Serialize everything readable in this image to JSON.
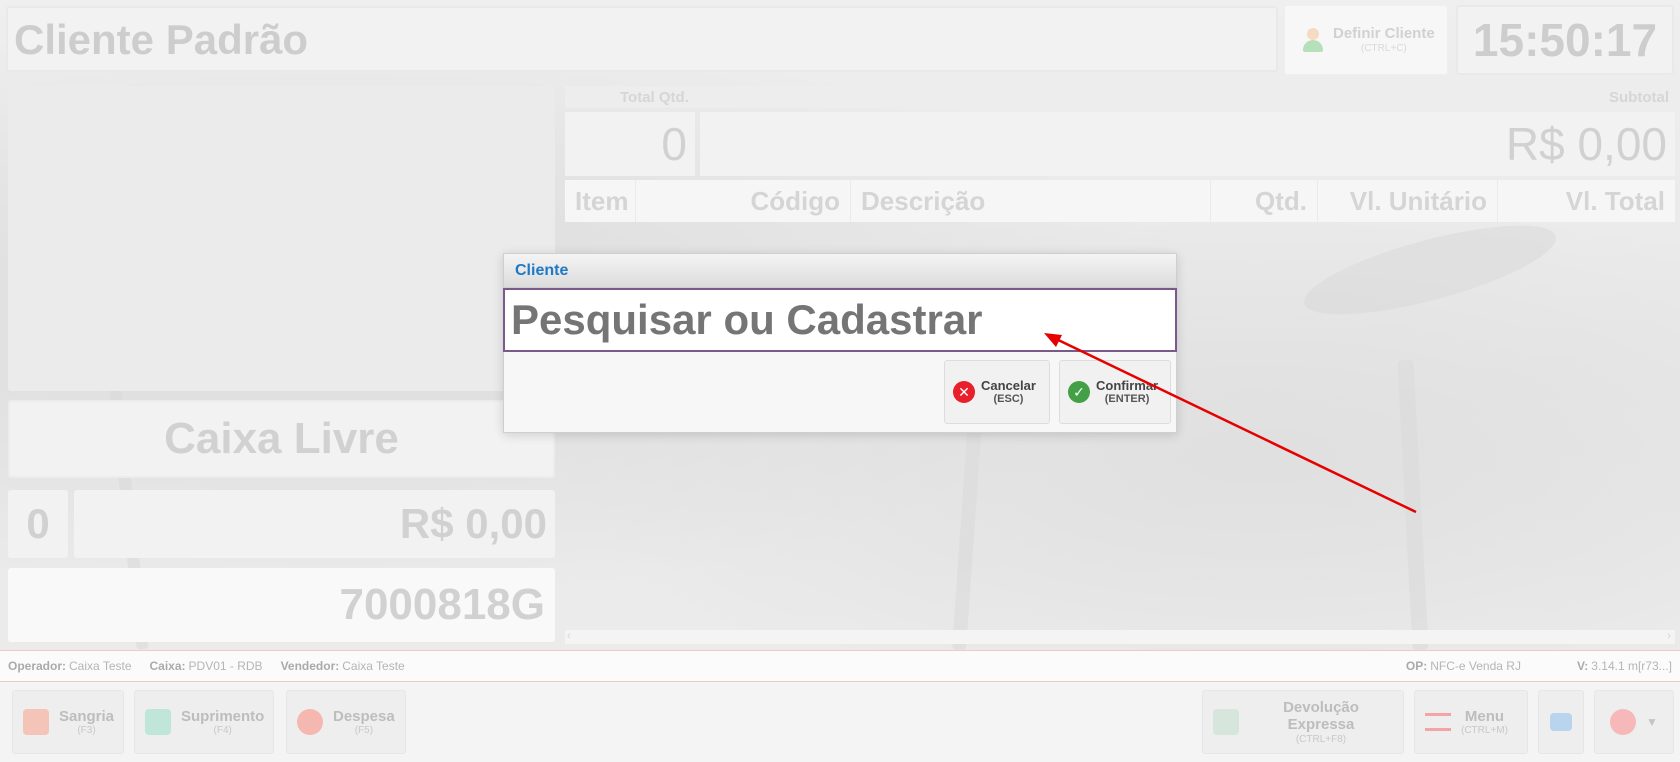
{
  "header": {
    "client_name": "Cliente Padrão",
    "define_client_label": "Definir Cliente",
    "define_client_shortcut": "(CTRL+C)",
    "clock": "15:50:17"
  },
  "left": {
    "status": "Caixa Livre",
    "item_count": "0",
    "total": "R$ 0,00",
    "code": "7000818G"
  },
  "totals": {
    "qty_label": "Total Qtd.",
    "qty_value": "0",
    "subtotal_label": "Subtotal",
    "subtotal_value": "R$ 0,00"
  },
  "table": {
    "columns": [
      "Item",
      "Código",
      "Descrição",
      "Qtd.",
      "Vl. Unitário",
      "Vl. Total"
    ],
    "rows": []
  },
  "status_line": {
    "operator_label": "Operador:",
    "operator_value": "Caixa Teste",
    "register_label": "Caixa:",
    "register_value": "PDV01 - RDB",
    "seller_label": "Vendedor:",
    "seller_value": "Caixa Teste",
    "op_label": "OP:",
    "op_value": "NFC-e Venda RJ",
    "version_label": "V:",
    "version_value": "3.14.1 m[r73...]"
  },
  "toolbar": {
    "sangria": {
      "label": "Sangria",
      "shortcut": "(F3)"
    },
    "suprimento": {
      "label": "Suprimento",
      "shortcut": "(F4)"
    },
    "despesa": {
      "label": "Despesa",
      "shortcut": "(F5)"
    },
    "devolucao": {
      "label": "Devolução Expressa",
      "shortcut": "(CTRL+F8)"
    },
    "menu": {
      "label": "Menu",
      "shortcut": "(CTRL+M)"
    }
  },
  "dialog": {
    "title": "Cliente",
    "input_placeholder": "Pesquisar ou Cadastrar",
    "input_value": "",
    "cancel_label": "Cancelar",
    "cancel_shortcut": "(ESC)",
    "confirm_label": "Confirmar",
    "confirm_shortcut": "(ENTER)"
  },
  "colors": {
    "accent_title": "#1f79c4",
    "cancel_icon": "#e8202a",
    "confirm_icon": "#43a047",
    "annotation_arrow": "#e60000"
  }
}
